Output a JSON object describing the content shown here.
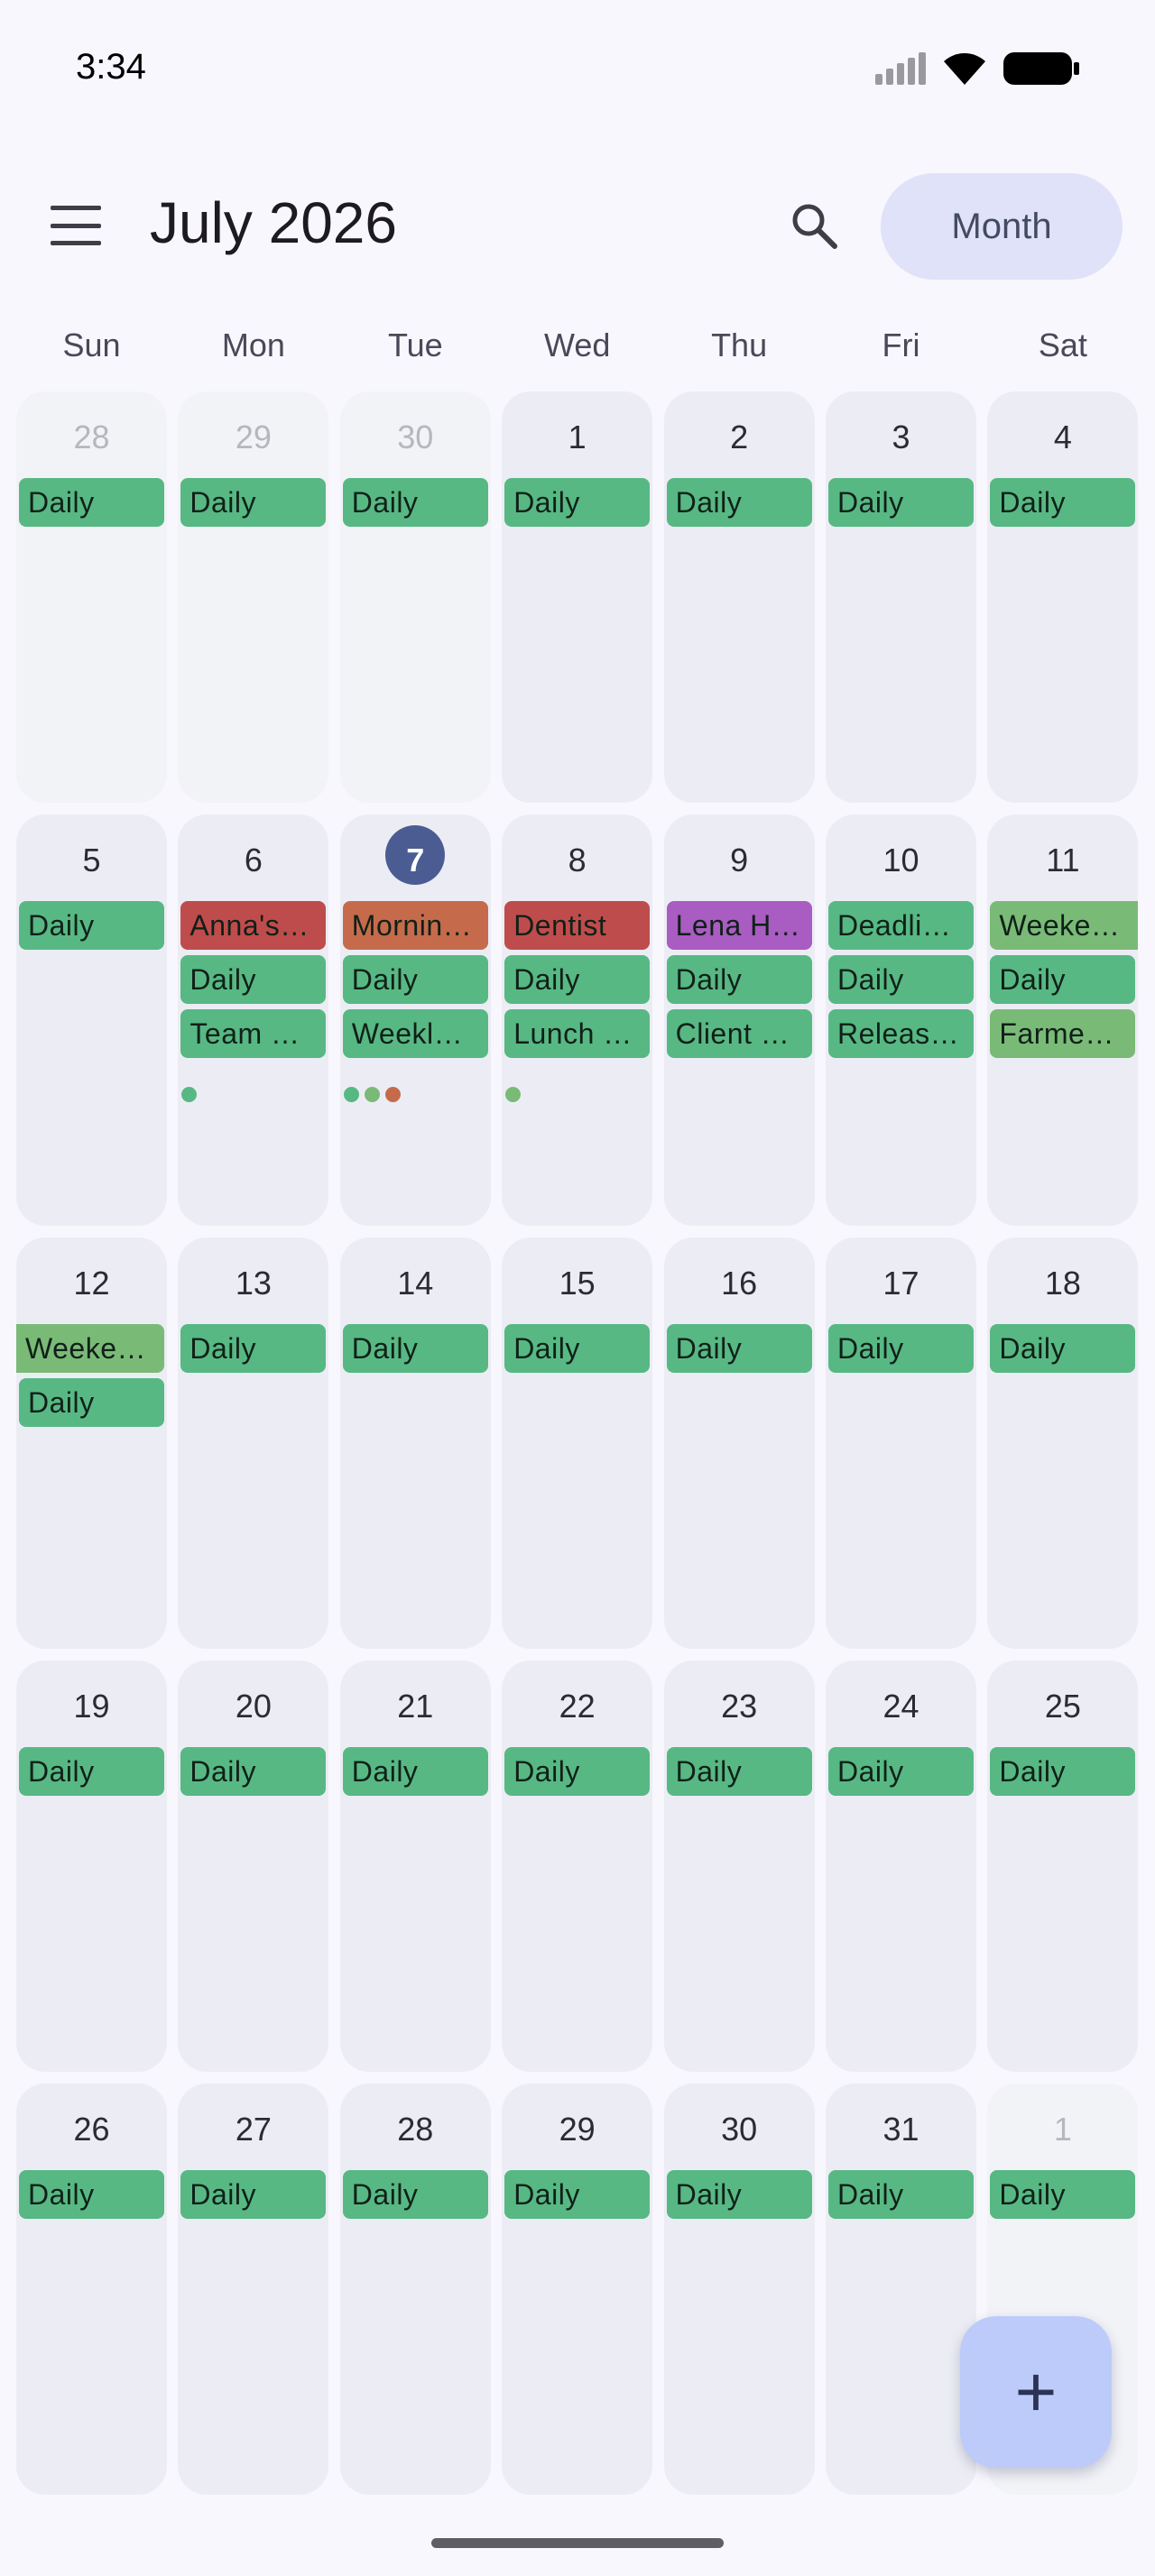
{
  "status": {
    "time": "3:34"
  },
  "header": {
    "title": "July 2026",
    "view_label": "Month"
  },
  "weekdays": [
    "Sun",
    "Mon",
    "Tue",
    "Wed",
    "Thu",
    "Fri",
    "Sat"
  ],
  "colors": {
    "daily": "#57b884",
    "green_light": "#7aba77",
    "red": "#bf4c4c",
    "orange": "#c56b4b",
    "purple": "#a95cc1",
    "today": "#4b5c93"
  },
  "weeks": [
    [
      {
        "label": "28",
        "other": true,
        "events": [
          {
            "title": "Daily",
            "color": "daily"
          }
        ]
      },
      {
        "label": "29",
        "other": true,
        "events": [
          {
            "title": "Daily",
            "color": "daily"
          }
        ]
      },
      {
        "label": "30",
        "other": true,
        "events": [
          {
            "title": "Daily",
            "color": "daily"
          }
        ]
      },
      {
        "label": "1",
        "events": [
          {
            "title": "Daily",
            "color": "daily"
          }
        ]
      },
      {
        "label": "2",
        "events": [
          {
            "title": "Daily",
            "color": "daily"
          }
        ]
      },
      {
        "label": "3",
        "events": [
          {
            "title": "Daily",
            "color": "daily"
          }
        ]
      },
      {
        "label": "4",
        "events": [
          {
            "title": "Daily",
            "color": "daily"
          }
        ]
      }
    ],
    [
      {
        "label": "5",
        "events": [
          {
            "title": "Daily",
            "color": "daily"
          }
        ]
      },
      {
        "label": "6",
        "events": [
          {
            "title": "Anna's…",
            "color": "red"
          },
          {
            "title": "Daily",
            "color": "daily"
          },
          {
            "title": "Team …",
            "color": "daily"
          }
        ],
        "more_dots": [
          "daily"
        ]
      },
      {
        "label": "7",
        "today": true,
        "events": [
          {
            "title": "Mornin…",
            "color": "orange"
          },
          {
            "title": "Daily",
            "color": "daily"
          },
          {
            "title": "Weekl…",
            "color": "daily"
          }
        ],
        "more_dots": [
          "daily",
          "green_light",
          "orange"
        ]
      },
      {
        "label": "8",
        "events": [
          {
            "title": "Dentist",
            "color": "red"
          },
          {
            "title": "Daily",
            "color": "daily"
          },
          {
            "title": "Lunch …",
            "color": "daily"
          }
        ],
        "more_dots": [
          "green_light"
        ]
      },
      {
        "label": "9",
        "events": [
          {
            "title": "Lena H…",
            "color": "purple"
          },
          {
            "title": "Daily",
            "color": "daily"
          },
          {
            "title": "Client …",
            "color": "daily"
          }
        ]
      },
      {
        "label": "10",
        "events": [
          {
            "title": "Deadli…",
            "color": "daily"
          },
          {
            "title": "Daily",
            "color": "daily"
          },
          {
            "title": "Releas…",
            "color": "daily"
          }
        ]
      },
      {
        "label": "11",
        "events": [
          {
            "title": "Weeke…",
            "color": "green_light",
            "span_right": true
          },
          {
            "title": "Daily",
            "color": "daily"
          },
          {
            "title": "Farme…",
            "color": "green_light"
          }
        ]
      }
    ],
    [
      {
        "label": "12",
        "events": [
          {
            "title": "Weeke…",
            "color": "green_light",
            "span_left": true
          },
          {
            "title": "Daily",
            "color": "daily"
          }
        ]
      },
      {
        "label": "13",
        "events": [
          {
            "title": "Daily",
            "color": "daily"
          }
        ]
      },
      {
        "label": "14",
        "events": [
          {
            "title": "Daily",
            "color": "daily"
          }
        ]
      },
      {
        "label": "15",
        "events": [
          {
            "title": "Daily",
            "color": "daily"
          }
        ]
      },
      {
        "label": "16",
        "events": [
          {
            "title": "Daily",
            "color": "daily"
          }
        ]
      },
      {
        "label": "17",
        "events": [
          {
            "title": "Daily",
            "color": "daily"
          }
        ]
      },
      {
        "label": "18",
        "events": [
          {
            "title": "Daily",
            "color": "daily"
          }
        ]
      }
    ],
    [
      {
        "label": "19",
        "events": [
          {
            "title": "Daily",
            "color": "daily"
          }
        ]
      },
      {
        "label": "20",
        "events": [
          {
            "title": "Daily",
            "color": "daily"
          }
        ]
      },
      {
        "label": "21",
        "events": [
          {
            "title": "Daily",
            "color": "daily"
          }
        ]
      },
      {
        "label": "22",
        "events": [
          {
            "title": "Daily",
            "color": "daily"
          }
        ]
      },
      {
        "label": "23",
        "events": [
          {
            "title": "Daily",
            "color": "daily"
          }
        ]
      },
      {
        "label": "24",
        "events": [
          {
            "title": "Daily",
            "color": "daily"
          }
        ]
      },
      {
        "label": "25",
        "events": [
          {
            "title": "Daily",
            "color": "daily"
          }
        ]
      }
    ],
    [
      {
        "label": "26",
        "events": [
          {
            "title": "Daily",
            "color": "daily"
          }
        ]
      },
      {
        "label": "27",
        "events": [
          {
            "title": "Daily",
            "color": "daily"
          }
        ]
      },
      {
        "label": "28",
        "events": [
          {
            "title": "Daily",
            "color": "daily"
          }
        ]
      },
      {
        "label": "29",
        "events": [
          {
            "title": "Daily",
            "color": "daily"
          }
        ]
      },
      {
        "label": "30",
        "events": [
          {
            "title": "Daily",
            "color": "daily"
          }
        ]
      },
      {
        "label": "31",
        "events": [
          {
            "title": "Daily",
            "color": "daily"
          }
        ]
      },
      {
        "label": "1",
        "other": true,
        "events": [
          {
            "title": "Daily",
            "color": "daily"
          }
        ]
      }
    ]
  ],
  "fab": {
    "icon": "plus-icon",
    "label": "+"
  }
}
